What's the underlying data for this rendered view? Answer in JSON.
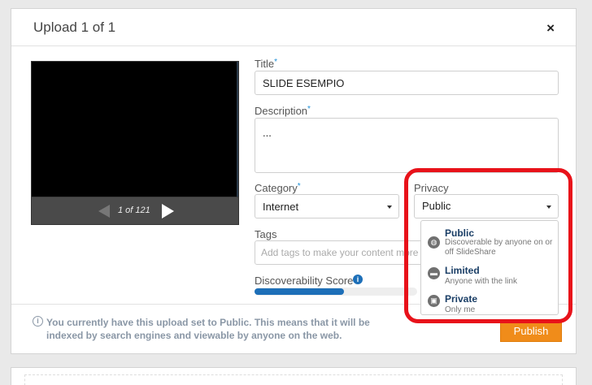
{
  "dialog": {
    "title": "Upload 1 of 1",
    "close_label": "×"
  },
  "preview": {
    "page_count": "1 of 121",
    "progress": 0.0
  },
  "form": {
    "title_label": "Title",
    "title_value": "SLIDE ESEMPIO",
    "description_label": "Description",
    "description_value": "...",
    "category_label": "Category",
    "category_value": "Internet",
    "privacy_label": "Privacy",
    "privacy_value": "Public",
    "tags_label": "Tags",
    "tags_placeholder": "Add tags to make your content more d",
    "score_label": "Discoverability Score",
    "score_fraction": 0.55,
    "required_mark": "*"
  },
  "privacy_options": [
    {
      "name": "Public",
      "desc": "Discoverable by anyone on or off SlideShare",
      "icon": "globe-icon"
    },
    {
      "name": "Limited",
      "desc": "Anyone with the link",
      "icon": "link-icon"
    },
    {
      "name": "Private",
      "desc": "Only me",
      "icon": "lock-icon"
    }
  ],
  "footer": {
    "notice": "You currently have this upload set to Public. This means that it will be indexed by search engines and viewable by anyone on the web.",
    "publish_label": "Publish"
  },
  "colors": {
    "accent": "#1d6fb8",
    "publish": "#f08c1a",
    "highlight": "#e8121a"
  }
}
